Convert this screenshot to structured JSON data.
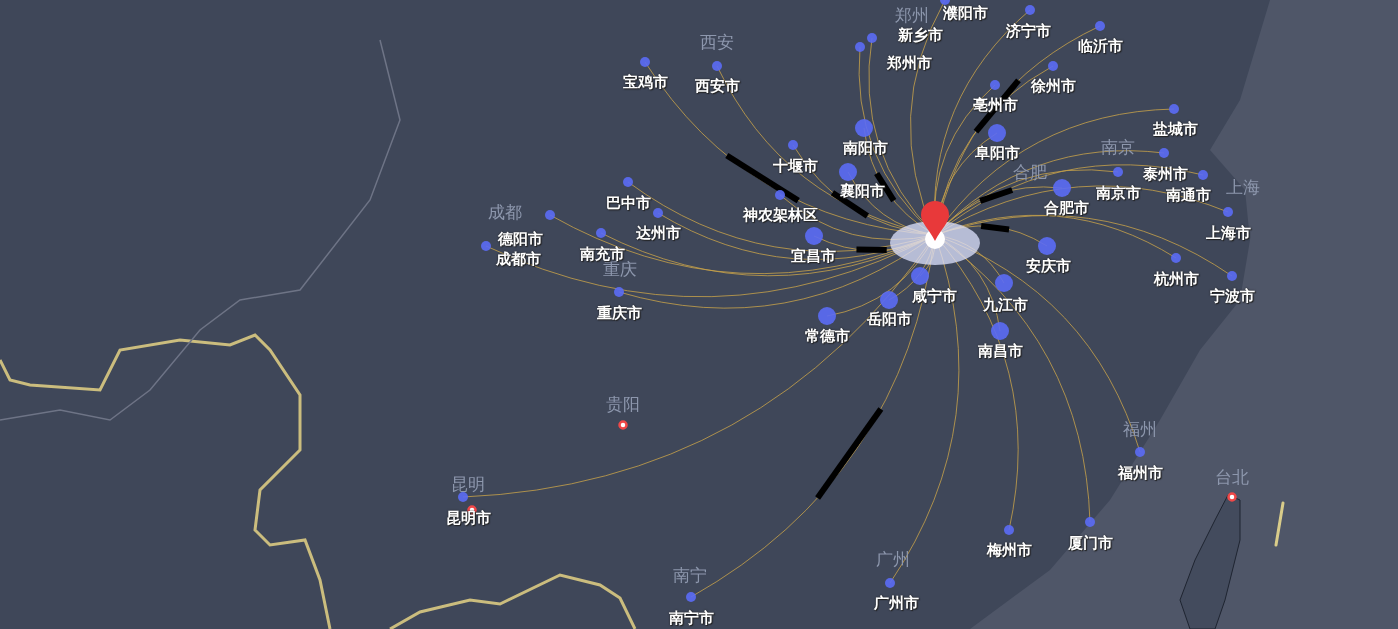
{
  "map": {
    "base_labels": [
      {
        "name": "西安"
      },
      {
        "name": "成都"
      },
      {
        "name": "重庆"
      },
      {
        "name": "贵阳"
      },
      {
        "name": "昆明"
      },
      {
        "name": "南宁"
      },
      {
        "name": "福州"
      },
      {
        "name": "台北"
      },
      {
        "name": "南京"
      },
      {
        "name": "合肥"
      },
      {
        "name": "上海"
      },
      {
        "name": "郑州"
      },
      {
        "name": "广州"
      }
    ],
    "cities": [
      {
        "name": "宝鸡市"
      },
      {
        "name": "西安市"
      },
      {
        "name": "郑州市"
      },
      {
        "name": "新乡市"
      },
      {
        "name": "濮阳市"
      },
      {
        "name": "济宁市"
      },
      {
        "name": "临沂市"
      },
      {
        "name": "徐州市"
      },
      {
        "name": "亳州市"
      },
      {
        "name": "阜阳市"
      },
      {
        "name": "南阳市"
      },
      {
        "name": "十堰市"
      },
      {
        "name": "盐城市"
      },
      {
        "name": "泰州市"
      },
      {
        "name": "南京市"
      },
      {
        "name": "南通市"
      },
      {
        "name": "合肥市"
      },
      {
        "name": "上海市"
      },
      {
        "name": "杭州市"
      },
      {
        "name": "宁波市"
      },
      {
        "name": "安庆市"
      },
      {
        "name": "九江市"
      },
      {
        "name": "南昌市"
      },
      {
        "name": "巴中市"
      },
      {
        "name": "达州市"
      },
      {
        "name": "南充市"
      },
      {
        "name": "德阳市"
      },
      {
        "name": "成都市"
      },
      {
        "name": "重庆市"
      },
      {
        "name": "神农架林区"
      },
      {
        "name": "宜昌市"
      },
      {
        "name": "襄阳市"
      },
      {
        "name": "常德市"
      },
      {
        "name": "岳阳市"
      },
      {
        "name": "咸宁市"
      },
      {
        "name": "昆明市"
      },
      {
        "name": "南宁市"
      },
      {
        "name": "广州市"
      },
      {
        "name": "梅州市"
      },
      {
        "name": "厦门市"
      },
      {
        "name": "福州市"
      }
    ]
  }
}
